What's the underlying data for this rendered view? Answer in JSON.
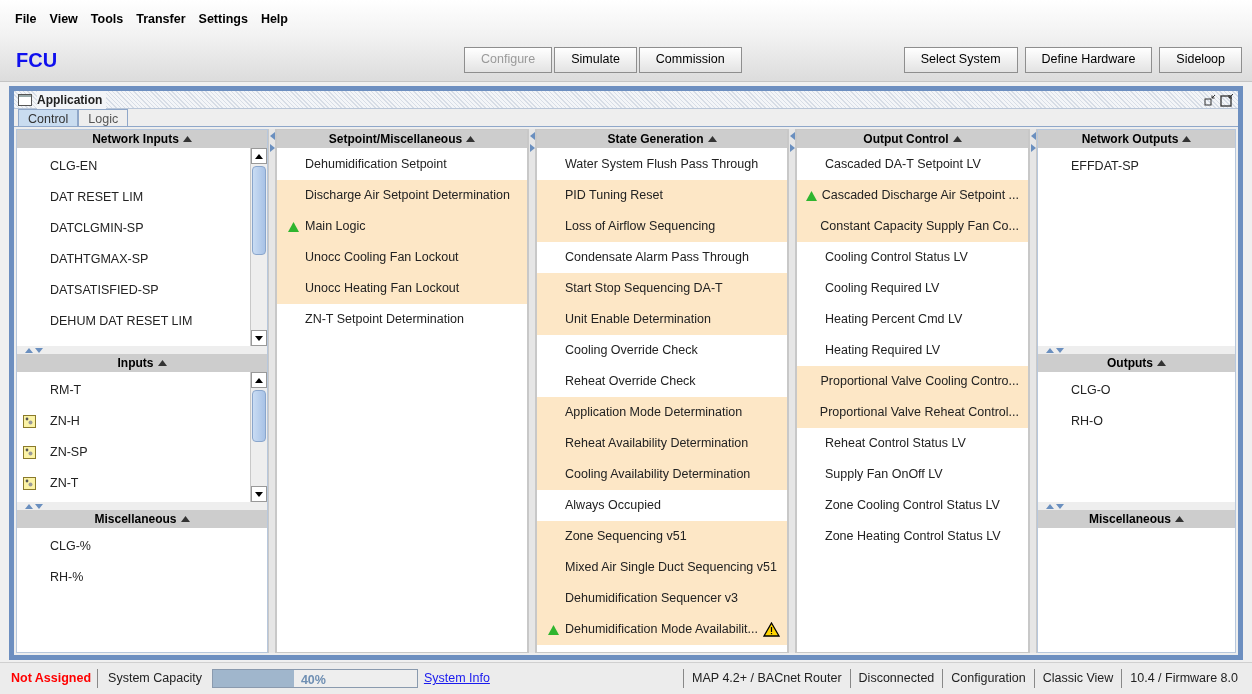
{
  "menu": [
    "File",
    "View",
    "Tools",
    "Transfer",
    "Settings",
    "Help"
  ],
  "app_title": "FCU",
  "mode_buttons": [
    {
      "label": "Configure",
      "disabled": true
    },
    {
      "label": "Simulate",
      "disabled": false
    },
    {
      "label": "Commission",
      "disabled": false
    }
  ],
  "action_buttons": [
    "Select System",
    "Define Hardware",
    "Sideloop"
  ],
  "window": {
    "title": "Application"
  },
  "tabs": [
    {
      "label": "Control",
      "selected": true
    },
    {
      "label": "Logic",
      "selected": false
    }
  ],
  "left_stack": [
    {
      "title": "Network Inputs",
      "scrollable": true,
      "items": [
        {
          "label": "CLG-EN",
          "icon": false
        },
        {
          "label": "DAT RESET LIM",
          "icon": false
        },
        {
          "label": "DATCLGMIN-SP",
          "icon": false
        },
        {
          "label": "DATHTGMAX-SP",
          "icon": false
        },
        {
          "label": "DATSATISFIED-SP",
          "icon": false
        },
        {
          "label": "DEHUM DAT RESET LIM",
          "icon": false
        }
      ]
    },
    {
      "title": "Inputs",
      "scrollable": true,
      "items": [
        {
          "label": "RM-T",
          "icon": false
        },
        {
          "label": "ZN-H",
          "icon": true
        },
        {
          "label": "ZN-SP",
          "icon": true
        },
        {
          "label": "ZN-T",
          "icon": true
        }
      ]
    },
    {
      "title": "Miscellaneous",
      "scrollable": false,
      "items": [
        {
          "label": "CLG-%",
          "icon": false
        },
        {
          "label": "RH-%",
          "icon": false
        }
      ]
    }
  ],
  "logic_columns": [
    {
      "title": "Setpoint/Miscellaneous",
      "items": [
        {
          "label": "Dehumidification Setpoint",
          "highlighted": false,
          "flagged": false,
          "warning": false
        },
        {
          "label": "Discharge Air Setpoint Determination",
          "highlighted": true,
          "flagged": false,
          "warning": false
        },
        {
          "label": "Main Logic",
          "highlighted": true,
          "flagged": true,
          "warning": false
        },
        {
          "label": "Unocc Cooling Fan Lockout",
          "highlighted": true,
          "flagged": false,
          "warning": false
        },
        {
          "label": "Unocc Heating Fan Lockout",
          "highlighted": true,
          "flagged": false,
          "warning": false
        },
        {
          "label": "ZN-T Setpoint Determination",
          "highlighted": false,
          "flagged": false,
          "warning": false
        }
      ]
    },
    {
      "title": "State Generation",
      "items": [
        {
          "label": "Water System Flush Pass Through",
          "highlighted": false,
          "flagged": false,
          "warning": false
        },
        {
          "label": "PID Tuning Reset",
          "highlighted": true,
          "flagged": false,
          "warning": false
        },
        {
          "label": "Loss of Airflow Sequencing",
          "highlighted": true,
          "flagged": false,
          "warning": false
        },
        {
          "label": "Condensate Alarm Pass Through",
          "highlighted": false,
          "flagged": false,
          "warning": false
        },
        {
          "label": "Start Stop Sequencing DA-T",
          "highlighted": true,
          "flagged": false,
          "warning": false
        },
        {
          "label": "Unit Enable Determination",
          "highlighted": true,
          "flagged": false,
          "warning": false
        },
        {
          "label": "Cooling Override Check",
          "highlighted": false,
          "flagged": false,
          "warning": false
        },
        {
          "label": "Reheat Override Check",
          "highlighted": false,
          "flagged": false,
          "warning": false
        },
        {
          "label": "Application Mode Determination",
          "highlighted": true,
          "flagged": false,
          "warning": false
        },
        {
          "label": "Reheat Availability Determination",
          "highlighted": true,
          "flagged": false,
          "warning": false
        },
        {
          "label": "Cooling Availability Determination",
          "highlighted": true,
          "flagged": false,
          "warning": false
        },
        {
          "label": "Always Occupied",
          "highlighted": false,
          "flagged": false,
          "warning": false
        },
        {
          "label": "Zone Sequencing v51",
          "highlighted": true,
          "flagged": false,
          "warning": false
        },
        {
          "label": "Mixed Air Single Duct Sequencing v51",
          "highlighted": true,
          "flagged": false,
          "warning": false
        },
        {
          "label": "Dehumidification Sequencer v3",
          "highlighted": true,
          "flagged": false,
          "warning": false
        },
        {
          "label": "Dehumidification Mode Availabilit...",
          "highlighted": true,
          "flagged": true,
          "warning": true
        }
      ]
    },
    {
      "title": "Output Control",
      "items": [
        {
          "label": "Cascaded DA-T Setpoint LV",
          "highlighted": false,
          "flagged": false,
          "warning": false
        },
        {
          "label": "Cascaded Discharge Air Setpoint ...",
          "highlighted": true,
          "flagged": true,
          "warning": false
        },
        {
          "label": "Constant Capacity Supply Fan Co...",
          "highlighted": true,
          "flagged": false,
          "warning": false
        },
        {
          "label": "Cooling Control Status LV",
          "highlighted": false,
          "flagged": false,
          "warning": false
        },
        {
          "label": "Cooling Required LV",
          "highlighted": false,
          "flagged": false,
          "warning": false
        },
        {
          "label": "Heating Percent Cmd LV",
          "highlighted": false,
          "flagged": false,
          "warning": false
        },
        {
          "label": "Heating Required LV",
          "highlighted": false,
          "flagged": false,
          "warning": false
        },
        {
          "label": "Proportional Valve Cooling Contro...",
          "highlighted": true,
          "flagged": false,
          "warning": false
        },
        {
          "label": "Proportional Valve Reheat Control...",
          "highlighted": true,
          "flagged": false,
          "warning": false
        },
        {
          "label": "Reheat Control Status LV",
          "highlighted": false,
          "flagged": false,
          "warning": false
        },
        {
          "label": "Supply Fan OnOff LV",
          "highlighted": false,
          "flagged": false,
          "warning": false
        },
        {
          "label": "Zone Cooling Control Status LV",
          "highlighted": false,
          "flagged": false,
          "warning": false
        },
        {
          "label": "Zone Heating Control Status LV",
          "highlighted": false,
          "flagged": false,
          "warning": false
        }
      ]
    }
  ],
  "right_stack": [
    {
      "title": "Network Outputs",
      "scrollable": false,
      "items": [
        {
          "label": "EFFDAT-SP",
          "icon": false
        }
      ]
    },
    {
      "title": "Outputs",
      "scrollable": false,
      "items": [
        {
          "label": "CLG-O",
          "icon": false
        },
        {
          "label": "RH-O",
          "icon": false
        }
      ]
    },
    {
      "title": "Miscellaneous",
      "scrollable": false
    }
  ],
  "status_bar": {
    "assignment": "Not Assigned",
    "capacity_label": "System Capacity",
    "capacity": {
      "level": 0.4,
      "reading": "40%"
    },
    "info_link": "System Info",
    "segments": [
      "MAP 4.2+ / BACnet Router",
      "Disconnected",
      "Configuration",
      "Classic View",
      "10.4 / Firmware 8.0"
    ]
  }
}
